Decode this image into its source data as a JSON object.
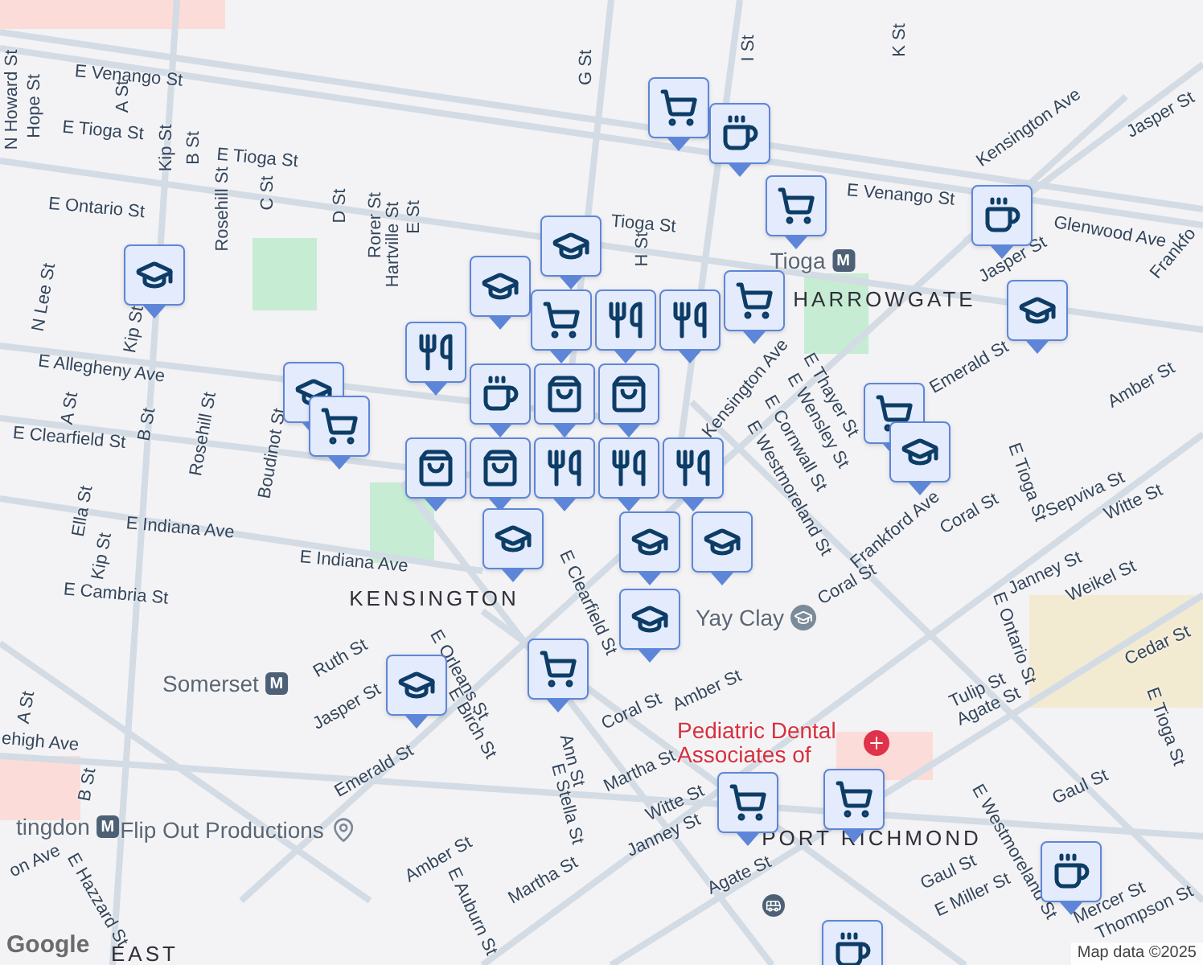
{
  "map": {
    "streets": [
      "E Venango St",
      "E Tioga St",
      "E Tioga St",
      "E Ontario St",
      "E Allegheny Ave",
      "E Clearfield St",
      "E Indiana Ave",
      "E Indiana Ave",
      "E Cambria St",
      "N Howard St",
      "Hope St",
      "A St",
      "Kip St",
      "B St",
      "Rosehill St",
      "C St",
      "D St",
      "Rorer St",
      "Hartville St",
      "E St",
      "G St",
      "H St",
      "I St",
      "K St",
      "N Lee St",
      "Kip St",
      "A St",
      "B St",
      "Rosehill St",
      "Boudinot St",
      "Ella St",
      "Kip St",
      "E Venango St",
      "Tioga St",
      "Kensington Ave",
      "Glenwood Ave",
      "Jasper St",
      "Jasper St",
      "Frankfo",
      "Kensington Ave",
      "E Thayer St",
      "E Wensley St",
      "E Cornwall St",
      "E Westmoreland St",
      "Emerald St",
      "Amber St",
      "Frankford Ave",
      "Coral St",
      "Coral St",
      "E Tioga St",
      "Sepviva St",
      "Witte St",
      "Janney St",
      "Weikel St",
      "E Ontario St",
      "Tulip St",
      "Agate St",
      "Cedar St",
      "E Tioga St",
      "Gaul St",
      "Gaul St",
      "E Miller St",
      "Mercer St",
      "Thompson St",
      "E Westmoreland St",
      "Amber St",
      "Coral St",
      "Martha St",
      "Witte St",
      "Janney St",
      "Agate St",
      "Ruth St",
      "Jasper St",
      "Emerald St",
      "E Orleans St",
      "E Birch St",
      "E Clearfield St",
      "Ann St",
      "E Stella St",
      "Martha St",
      "Amber St",
      "E Auburn St",
      "E Hazzard St",
      "ehigh Ave",
      "A St",
      "B St",
      "on Ave"
    ],
    "areas": [
      "HARROWGATE",
      "KENSINGTON",
      "PORT RICHMOND",
      "EAST"
    ],
    "places": [
      {
        "name": "Tioga",
        "kind": "station",
        "badge": "M"
      },
      {
        "name": "Somerset",
        "kind": "station",
        "badge": "M"
      },
      {
        "name": "tingdon",
        "kind": "station",
        "badge": "M"
      },
      {
        "name": "Flip Out Productions",
        "kind": "place"
      },
      {
        "name": "Yay Clay",
        "kind": "school"
      },
      {
        "name": "Pediatric Dental Associates of",
        "kind": "hospital"
      }
    ],
    "pins": [
      {
        "kind": "cart"
      },
      {
        "kind": "coffee"
      },
      {
        "kind": "cart"
      },
      {
        "kind": "coffee"
      },
      {
        "kind": "school"
      },
      {
        "kind": "school"
      },
      {
        "kind": "school"
      },
      {
        "kind": "cart"
      },
      {
        "kind": "food"
      },
      {
        "kind": "school"
      },
      {
        "kind": "cart"
      },
      {
        "kind": "coffee"
      },
      {
        "kind": "food"
      },
      {
        "kind": "food"
      },
      {
        "kind": "food"
      },
      {
        "kind": "cart"
      },
      {
        "kind": "cart"
      },
      {
        "kind": "school"
      },
      {
        "kind": "school"
      },
      {
        "kind": "bag"
      },
      {
        "kind": "bag"
      },
      {
        "kind": "food"
      },
      {
        "kind": "bag"
      },
      {
        "kind": "bag"
      },
      {
        "kind": "food"
      },
      {
        "kind": "school"
      },
      {
        "kind": "school"
      },
      {
        "kind": "school"
      },
      {
        "kind": "school"
      },
      {
        "kind": "school"
      },
      {
        "kind": "cart"
      },
      {
        "kind": "cart"
      },
      {
        "kind": "cart"
      },
      {
        "kind": "coffee"
      },
      {
        "kind": "coffee"
      }
    ],
    "logo": "Google",
    "attribution": "Map data ©2025"
  }
}
